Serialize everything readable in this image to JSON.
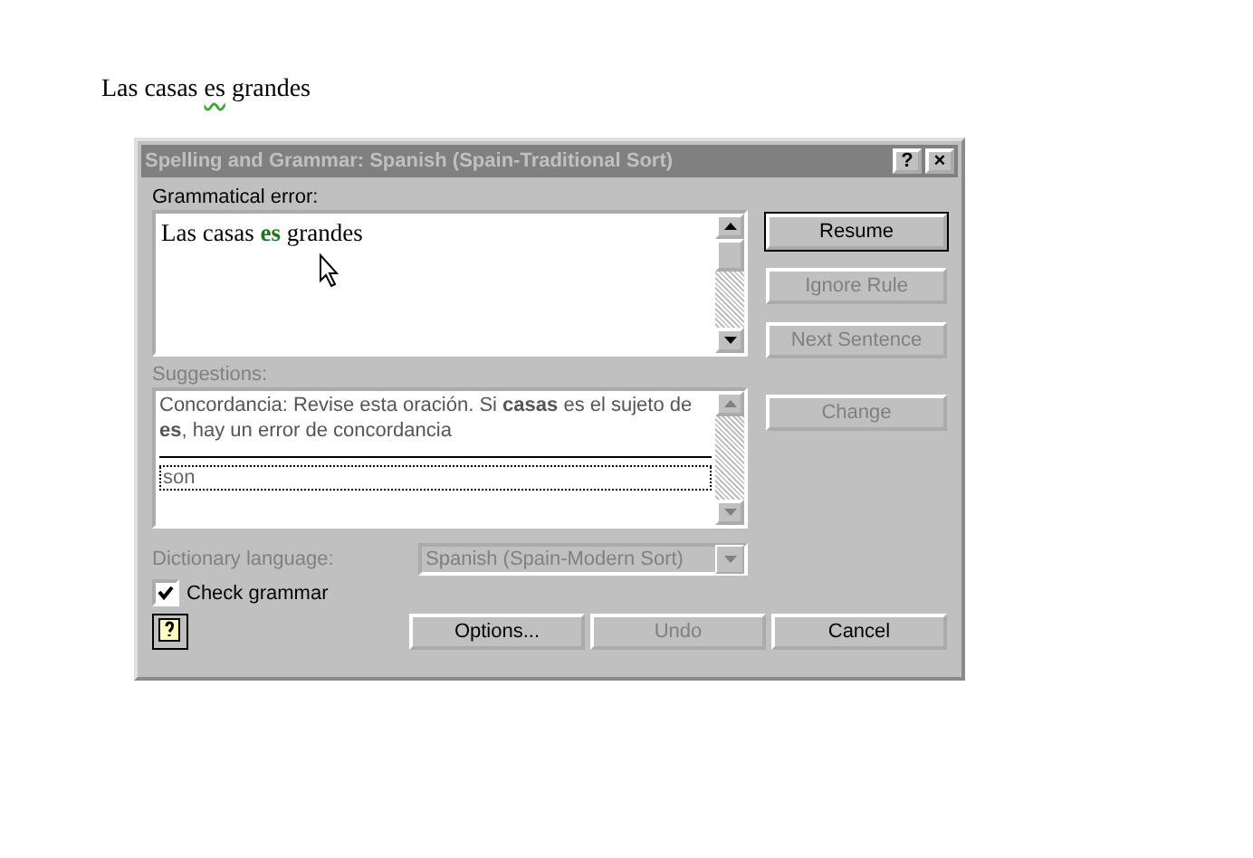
{
  "document": {
    "before": "Las casas ",
    "flagged": "es",
    "after": " grandes"
  },
  "window": {
    "title": "Spelling and Grammar: Spanish (Spain-Traditional Sort)",
    "help_glyph": "?",
    "close_glyph": "×"
  },
  "error_label": "Grammatical error:",
  "error_text": "Las casas **es** grandes",
  "suggestions_label": "Suggestions:",
  "suggestion_message": "Concordancia: Revise esta oración. Si **casas** es el sujeto de **es**, hay un error de concordancia",
  "suggestions": [
    {
      "text": "son",
      "selected": true
    }
  ],
  "side_buttons": [
    {
      "label": "Resume",
      "disabled": false,
      "default": true
    },
    {
      "label": "Ignore Rule",
      "disabled": true,
      "default": false
    },
    {
      "label": "Next Sentence",
      "disabled": true,
      "default": false
    },
    {
      "label": "Change",
      "disabled": true,
      "default": false
    }
  ],
  "dictionary": {
    "label": "Dictionary language:",
    "value": "Spanish (Spain-Modern Sort)",
    "disabled": true
  },
  "check_grammar": {
    "label": "Check grammar",
    "checked": true
  },
  "bottom_buttons": [
    {
      "label": "Options...",
      "disabled": false
    },
    {
      "label": "Undo",
      "disabled": true
    },
    {
      "label": "Cancel",
      "disabled": false
    }
  ]
}
